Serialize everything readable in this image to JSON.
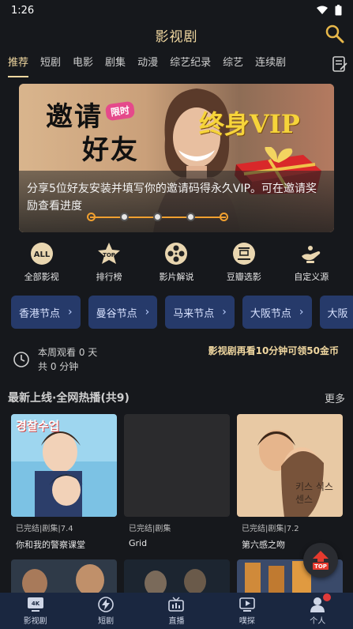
{
  "status": {
    "time": "1:26"
  },
  "header": {
    "title": "影视剧"
  },
  "tabs": [
    {
      "label": "推荐"
    },
    {
      "label": "短剧"
    },
    {
      "label": "电影"
    },
    {
      "label": "剧集"
    },
    {
      "label": "动漫"
    },
    {
      "label": "综艺纪录"
    },
    {
      "label": "综艺"
    },
    {
      "label": "连续剧"
    }
  ],
  "banner": {
    "invite": "邀请",
    "friend": "好友",
    "limited": "限时",
    "vip": "终身VIP",
    "caption": "分享5位好友安装并填写你的邀请码得永久VIP。可在邀请奖励查看进度",
    "active_index": 4,
    "total": 5
  },
  "quick": [
    {
      "label": "全部影视",
      "icon": "all-icon"
    },
    {
      "label": "排行榜",
      "icon": "top-icon"
    },
    {
      "label": "影片解说",
      "icon": "film-reel-icon"
    },
    {
      "label": "豆瓣选影",
      "icon": "douban-icon"
    },
    {
      "label": "自定义源",
      "icon": "genie-lamp-icon"
    }
  ],
  "nodes": [
    {
      "label": "香港节点"
    },
    {
      "label": "曼谷节点"
    },
    {
      "label": "马来节点"
    },
    {
      "label": "大阪节点"
    },
    {
      "label": "大阪"
    }
  ],
  "watch": {
    "line1": "本周观看 0 天",
    "line2": "共 0 分钟",
    "reward": "影视剧再看10分钟可领50金币"
  },
  "section": {
    "title": "最新上线·全网热播(共9)",
    "more": "更多"
  },
  "cards": [
    {
      "meta": "已完结|剧集|7.4",
      "title": "你和我的警察课堂",
      "poster_text": "경찰수업"
    },
    {
      "meta": "已完结|剧集",
      "title": "Grid",
      "poster_text": ""
    },
    {
      "meta": "已完结|剧集|7.2",
      "title": "第六感之吻",
      "poster_text": "키스 식스센스"
    }
  ],
  "top_button": {
    "label": "TOP"
  },
  "bottom_nav": [
    {
      "label": "影视剧",
      "icon": "tv-4k-icon"
    },
    {
      "label": "短剧",
      "icon": "lightning-icon"
    },
    {
      "label": "直播",
      "icon": "live-tv-icon"
    },
    {
      "label": "噗探",
      "icon": "play-screen-icon"
    },
    {
      "label": "个人",
      "icon": "user-icon"
    }
  ],
  "colors": {
    "accent_gold": "#f0d7a0",
    "node_bg": "#263a6a",
    "nav_bg": "#1a2740",
    "badge_red": "#e03a3a"
  }
}
